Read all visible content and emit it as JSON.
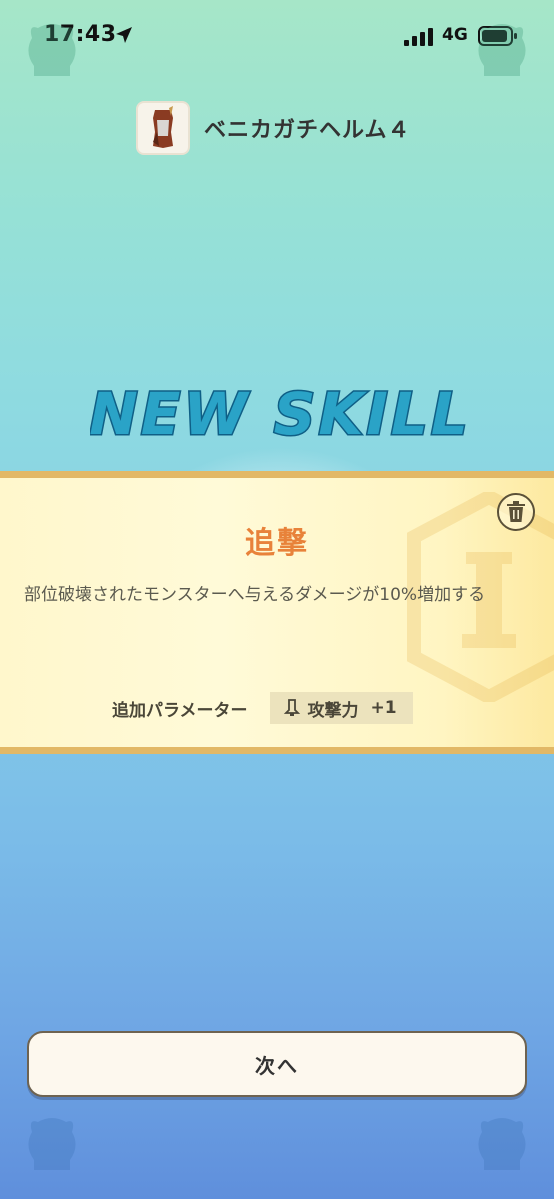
{
  "status_bar": {
    "time": "17:43",
    "network": "4G"
  },
  "item": {
    "name": "ベニカガチヘルム４"
  },
  "banner": {
    "title": "NEW SKILL"
  },
  "skill": {
    "name": "追撃",
    "description": "部位破壊されたモンスターへ与えるダメージが10%増加する",
    "param_label": "追加パラメーター",
    "param_name": "攻撃力",
    "param_value": "+1"
  },
  "actions": {
    "next_label": "次へ"
  },
  "colors": {
    "skill_name": "#e8823a",
    "panel_border": "#e2b866",
    "banner_text": "#2aa3c7"
  }
}
